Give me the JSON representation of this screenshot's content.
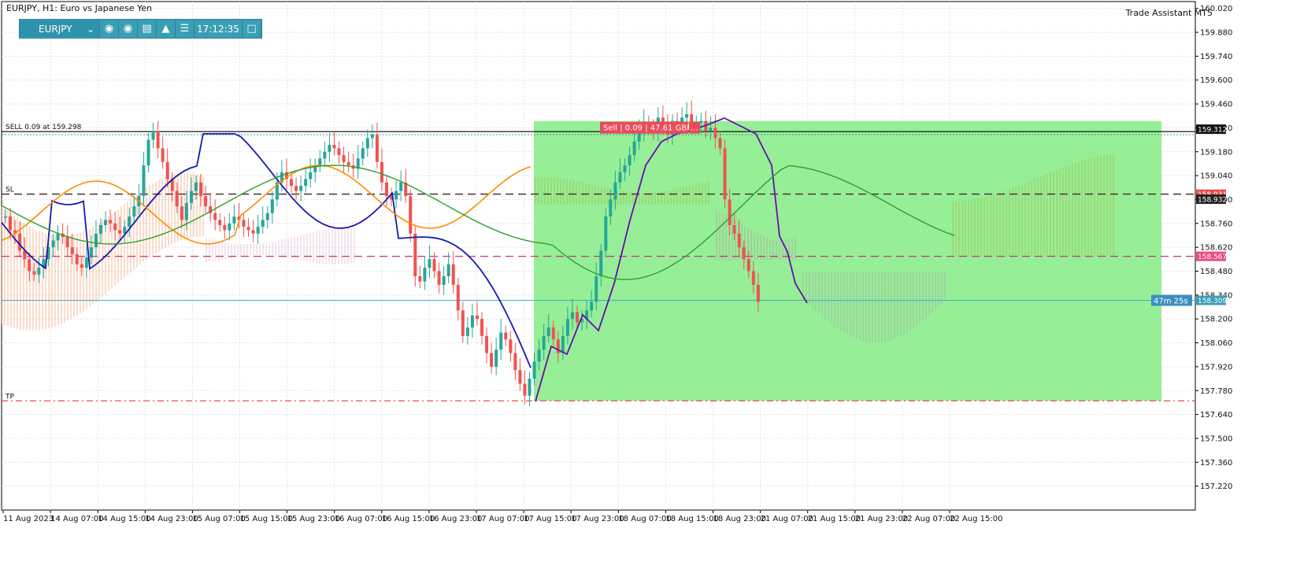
{
  "window": {
    "title": "EURJPY, H1:  Euro vs Japanese Yen",
    "trade_assistant_label": "Trade Assistant MT5"
  },
  "toolbar": {
    "symbol": "EURJPY",
    "time": "17:12:35",
    "icons": [
      "camera-icon",
      "eye-icon",
      "calendar-icon",
      "alarm-icon",
      "menu-icon",
      "window-icon"
    ]
  },
  "colors": {
    "bull": "#26a69a",
    "bear": "#ef5350",
    "blue_line": "#1818b0",
    "purple_line": "#6a0dad",
    "orange_line": "#ff8c00",
    "green_line": "#2ca02c",
    "trade_zone": "#90ee90",
    "sell_label_bg": "#e84c5a",
    "current_price_bg": "#3a8fbf"
  },
  "chart_data": {
    "type": "candlestick",
    "symbol": "EURJPY",
    "timeframe": "H1",
    "ylim": [
      157.08,
      160.06
    ],
    "y_ticks": [
      "160.020",
      "159.880",
      "159.740",
      "159.600",
      "159.460",
      "159.320",
      "159.180",
      "159.040",
      "158.900",
      "158.760",
      "158.620",
      "158.480",
      "158.340",
      "158.200",
      "158.060",
      "157.920",
      "157.780",
      "157.640",
      "157.500",
      "157.360",
      "157.220"
    ],
    "x_ticks": [
      "11 Aug 2023",
      "14 Aug 07:00",
      "14 Aug 15:00",
      "14 Aug 23:00",
      "15 Aug 07:00",
      "15 Aug 15:00",
      "15 Aug 23:00",
      "16 Aug 07:00",
      "16 Aug 15:00",
      "16 Aug 23:00",
      "17 Aug 07:00",
      "17 Aug 15:00",
      "17 Aug 23:00",
      "18 Aug 07:00",
      "18 Aug 15:00",
      "18 Aug 23:00",
      "21 Aug 07:00",
      "21 Aug 15:00",
      "21 Aug 23:00",
      "22 Aug 07:00",
      "22 Aug 15:00"
    ],
    "grid": true,
    "ohlc_closes": [
      158.8,
      158.72,
      158.7,
      158.6,
      158.55,
      158.48,
      158.46,
      158.5,
      158.55,
      158.62,
      158.66,
      158.7,
      158.68,
      158.62,
      158.58,
      158.52,
      158.5,
      158.56,
      158.62,
      158.7,
      158.75,
      158.78,
      158.76,
      158.72,
      158.7,
      158.74,
      158.8,
      158.86,
      158.92,
      159.1,
      159.25,
      159.3,
      159.2,
      159.12,
      159.02,
      158.95,
      158.86,
      158.78,
      158.88,
      158.95,
      159.0,
      158.92,
      158.86,
      158.82,
      158.78,
      158.75,
      158.72,
      158.76,
      158.8,
      158.78,
      158.74,
      158.72,
      158.7,
      158.74,
      158.78,
      158.82,
      158.9,
      159.0,
      159.06,
      159.02,
      158.98,
      158.95,
      158.98,
      159.02,
      159.06,
      159.1,
      159.14,
      159.18,
      159.22,
      159.2,
      159.16,
      159.12,
      159.1,
      159.08,
      159.14,
      159.2,
      159.26,
      159.28,
      159.12,
      159.0,
      158.92,
      158.9,
      158.95,
      159.0,
      158.92,
      158.7,
      158.45,
      158.42,
      158.5,
      158.55,
      158.48,
      158.4,
      158.45,
      158.52,
      158.4,
      158.25,
      158.1,
      158.15,
      158.22,
      158.2,
      158.1,
      158.0,
      157.92,
      158.02,
      158.12,
      158.08,
      158.0,
      157.9,
      157.82,
      157.75,
      157.85,
      157.95,
      158.02,
      158.1,
      158.15,
      158.08,
      158.0,
      158.1,
      158.2,
      158.24,
      158.18,
      158.2,
      158.25,
      158.3,
      158.45,
      158.6,
      158.8,
      158.9,
      159.0,
      159.06,
      159.1,
      159.16,
      159.24,
      159.3,
      159.35,
      159.32,
      159.3,
      159.38,
      159.32,
      159.28,
      159.36,
      159.34,
      159.38,
      159.4,
      159.34,
      159.35,
      159.36,
      159.3,
      159.32,
      159.26,
      159.2,
      158.9,
      158.75,
      158.7,
      158.62,
      158.55,
      158.48,
      158.4,
      158.3
    ],
    "series": [
      {
        "name": "",
        "type": "line",
        "color": "#1818b0"
      },
      {
        "name": "",
        "type": "line",
        "color": "#6a0dad"
      },
      {
        "name": "",
        "type": "line",
        "color": "#ff8c00"
      },
      {
        "name": "",
        "type": "line",
        "color": "#2ca02c"
      }
    ],
    "horizontal_lines": [
      {
        "label": "SELL 0.09 at 159.298",
        "price": 159.298,
        "style": "solid",
        "color": "#000000"
      },
      {
        "label": "SL",
        "price": 158.931,
        "style": "dashed",
        "color": "#e84c4c"
      },
      {
        "label": "",
        "price": 158.932,
        "style": "dashed",
        "color": "#333333"
      },
      {
        "label": "",
        "price": 158.567,
        "style": "dashed",
        "color": "#c8327a"
      },
      {
        "label": "",
        "price": 158.309,
        "style": "solid",
        "color": "#48b3c9"
      },
      {
        "label": "TP",
        "price": 157.72,
        "style": "dashdot",
        "color": "#e84c4c"
      }
    ],
    "price_labels": {
      "entry": "159.312",
      "sl": "158.931",
      "black": "158.932",
      "magenta": "158.567",
      "current": "158.309"
    },
    "trade_box": {
      "top_price": 159.36,
      "bottom_price": 157.72
    },
    "sell_label": "Sell | 0.09 | 47.61 GBP",
    "sell_label_close": "...",
    "countdown": "47m  25s"
  }
}
